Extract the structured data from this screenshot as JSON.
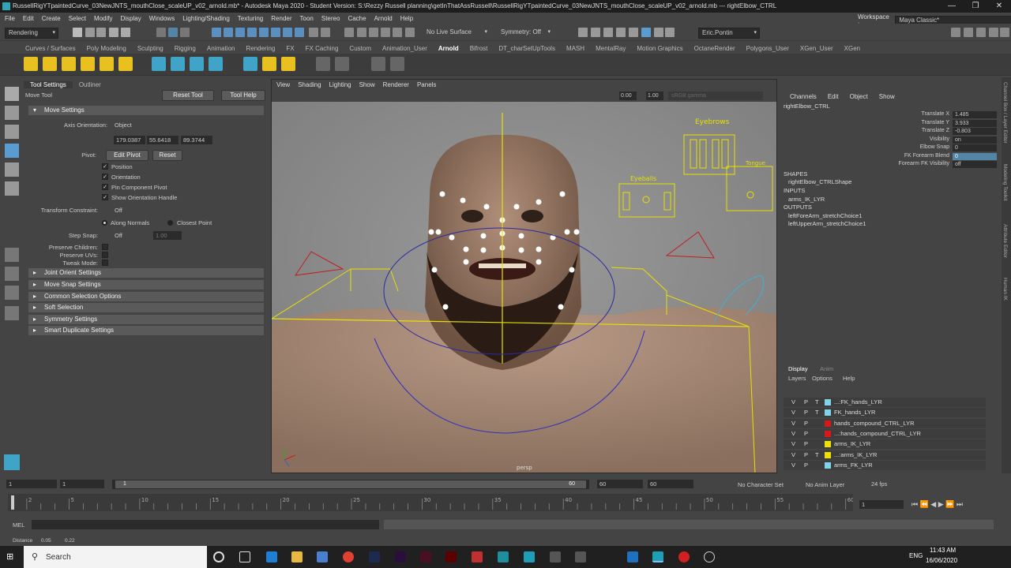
{
  "titlebar": {
    "title": "RussellRigYTpaintedCurve_03NewJNTS_mouthClose_scaleUP_v02_arnold.mb* - Autodesk Maya 2020 - Student Version: S:\\Rezzy Russell planning\\getInThatAssRussell\\RussellRigYTpaintedCurve_03NewJNTS_mouthClose_scaleUP_v02_arnold.mb   ---   rightElbow_CTRL",
    "minimize": "—",
    "restore": "❐",
    "close": "✕"
  },
  "menubar": {
    "items": [
      "File",
      "Edit",
      "Create",
      "Select",
      "Modify",
      "Display",
      "Windows",
      "Lighting/Shading",
      "Texturing",
      "Render",
      "Toon",
      "Stereo",
      "Cache",
      "Arnold",
      "Help"
    ],
    "workspace_label": "Workspace :",
    "workspace_value": "Maya Classic*"
  },
  "statusline": {
    "menuset": "Rendering",
    "live_surface": "No Live Surface",
    "symmetry": "Symmetry: Off",
    "user": "Eric.Pontin"
  },
  "shelf": {
    "tabs": [
      "Curves / Surfaces",
      "Poly Modeling",
      "Sculpting",
      "Rigging",
      "Animation",
      "Rendering",
      "FX",
      "FX Caching",
      "Custom",
      "Animation_User",
      "Arnold",
      "Bifrost",
      "DT_charSetUpTools",
      "MASH",
      "MentalRay",
      "Motion Graphics",
      "OctaneRender",
      "Polygons_User",
      "XGen_User",
      "XGen"
    ],
    "active_tab": "Arnold"
  },
  "toolsettings": {
    "tabs": [
      "Tool Settings",
      "Outliner"
    ],
    "tool_name": "Move Tool",
    "reset_tool": "Reset Tool",
    "tool_help": "Tool Help",
    "move_settings": "Move Settings",
    "axis_orientation_label": "Axis Orientation:",
    "axis_orientation_value": "Object",
    "axis_values": [
      "179.0387",
      "55.6418",
      "89.3744"
    ],
    "pivot_label": "Pivot:",
    "edit_pivot": "Edit Pivot",
    "reset": "Reset",
    "checkboxes": [
      "Position",
      "Orientation",
      "Pin Component Pivot",
      "Show Orientation Handle"
    ],
    "transform_constraint_label": "Transform Constraint:",
    "transform_constraint_value": "Off",
    "along_normals": "Along Normals",
    "closest_point": "Closest Point",
    "step_snap_label": "Step Snap:",
    "step_snap_value": "Off",
    "step_snap_num": "1.00",
    "preserve_children": "Preserve Children:",
    "preserve_uvs": "Preserve UVs:",
    "tweak_mode": "Tweak Mode:",
    "sections": [
      "Joint Orient Settings",
      "Move Snap Settings",
      "Common Selection Options",
      "Soft Selection",
      "Symmetry Settings",
      "Smart Duplicate Settings"
    ]
  },
  "viewport": {
    "menu": [
      "View",
      "Shading",
      "Lighting",
      "Show",
      "Renderer",
      "Panels"
    ],
    "exposure": "0.00",
    "gamma": "1.00",
    "colorspace": "sRGB gamma",
    "camera": "persp",
    "labels": {
      "eyebrows": "Eyebrows",
      "eyeballs": "Eyeballs",
      "tongue": "Tongue"
    }
  },
  "channelbox": {
    "menu": [
      "Channels",
      "Edit",
      "Object",
      "Show"
    ],
    "object": "rightElbow_CTRL",
    "channels": [
      {
        "name": "Translate X",
        "value": "1.485",
        "hl": false
      },
      {
        "name": "Translate Y",
        "value": "3.933",
        "hl": false
      },
      {
        "name": "Translate Z",
        "value": "-0.803",
        "hl": false
      },
      {
        "name": "Visibility",
        "value": "on",
        "hl": false
      },
      {
        "name": "Elbow Snap",
        "value": "0",
        "hl": false
      },
      {
        "name": "FK Forearm Blend",
        "value": "0",
        "hl": true
      },
      {
        "name": "Forearm FK Visibility",
        "value": "off",
        "hl": false
      }
    ],
    "shapes_header": "SHAPES",
    "shape": "rightElbow_CTRLShape",
    "inputs_header": "INPUTS",
    "input": "arms_IK_LYR",
    "outputs_header": "OUTPUTS",
    "outputs": [
      "leftForeArm_stretchChoice1",
      "leftUpperArm_stretchChoice1"
    ]
  },
  "layereditor": {
    "tabs": [
      "Display",
      "Anim"
    ],
    "menu": [
      "Layers",
      "Options",
      "Help"
    ],
    "layers": [
      {
        "v": "V",
        "p": "P",
        "t": "T",
        "color": "#7fd4e8",
        "name": "...:FK_hands_LYR"
      },
      {
        "v": "V",
        "p": "P",
        "t": "T",
        "color": "#7fd4e8",
        "name": "FK_hands_LYR"
      },
      {
        "v": "V",
        "p": "P",
        "t": "",
        "color": "#d81818",
        "name": "hands_compound_CTRL_LYR"
      },
      {
        "v": "V",
        "p": "P",
        "t": "",
        "color": "#d81818",
        "name": "...:hands_compound_CTRL_LYR"
      },
      {
        "v": "V",
        "p": "P",
        "t": "",
        "color": "#f0e000",
        "name": "arms_IK_LYR"
      },
      {
        "v": "V",
        "p": "P",
        "t": "T",
        "color": "#f0e000",
        "name": "...:arms_IK_LYR"
      },
      {
        "v": "V",
        "p": "P",
        "t": "",
        "color": "#7fd4e8",
        "name": "arms_FK_LYR"
      }
    ]
  },
  "rightstrip": [
    "Channel Box / Layer Editor",
    "Modeling Toolkit",
    "Attribute Editor",
    "Human IK"
  ],
  "timeslider": {
    "ticks": [
      "1",
      "2",
      "3",
      "4",
      "5",
      "6",
      "7",
      "8",
      "9",
      "10",
      "11",
      "12",
      "13",
      "14",
      "15",
      "16",
      "17",
      "18",
      "19",
      "20",
      "21",
      "22",
      "23",
      "24",
      "25",
      "26",
      "27",
      "28",
      "29",
      "30",
      "31",
      "32",
      "33",
      "34",
      "35",
      "36",
      "37",
      "38",
      "39",
      "40",
      "41",
      "42",
      "43",
      "44",
      "45",
      "46",
      "47",
      "48",
      "49",
      "50",
      "51",
      "52",
      "53",
      "54",
      "55",
      "56",
      "57",
      "58",
      "59",
      "60"
    ],
    "labeled_ticks": [
      "2",
      "5",
      "10",
      "15",
      "20",
      "25",
      "30",
      "35",
      "40",
      "45",
      "50",
      "55",
      "60"
    ],
    "current_frame": "1",
    "range_start": "1",
    "range_start2": "1",
    "range_inner_start": "1",
    "range_inner_end": "60",
    "range_end": "60",
    "range_end2": "60",
    "character_set": "No Character Set",
    "anim_layer": "No Anim Layer",
    "fps": "24 fps"
  },
  "cmdline": {
    "label": "MEL"
  },
  "helpline": {
    "distance_label": "Distance",
    "d1": "0.05",
    "d2": "0.22"
  },
  "taskbar": {
    "search": "Search",
    "time": "11:43 AM",
    "date": "16/06/2020",
    "lang": "ENG"
  }
}
